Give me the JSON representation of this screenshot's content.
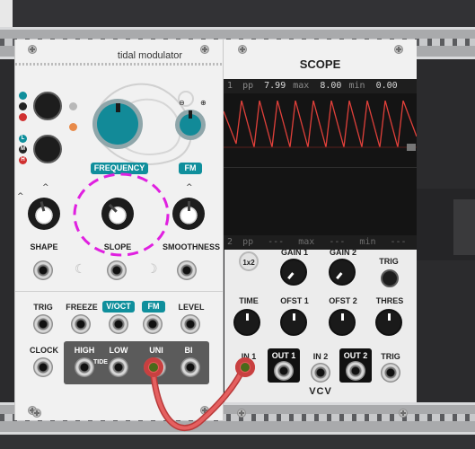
{
  "tidal": {
    "title": "tidal modulator",
    "frequency": "FREQUENCY",
    "fm": "FM",
    "shape": "SHAPE",
    "slope": "SLOPE",
    "smoothness": "SMOOTHNESS",
    "trig": "TRIG",
    "freeze": "FREEZE",
    "voct": "V/OCT",
    "fm2": "FM",
    "level": "LEVEL",
    "clock": "CLOCK",
    "high": "HIGH",
    "low": "LOW",
    "tide": "TIDE",
    "uni": "UNI",
    "bi": "BI",
    "leds_top": [
      "",
      "",
      ""
    ],
    "leds_bottom": [
      "L",
      "M",
      "H"
    ]
  },
  "scope": {
    "title": "SCOPE",
    "ch1": {
      "num": "1",
      "pp": "pp",
      "pp_val": "7.99",
      "max": "max",
      "max_val": "8.00",
      "min": "min",
      "min_val": "0.00"
    },
    "ch2": {
      "num": "2",
      "pp": "pp",
      "pp_val": "---",
      "max": "max",
      "max_val": "---",
      "min": "min",
      "min_val": "---"
    }
  },
  "vcv": {
    "x1x2": "1x2",
    "gain1": "GAIN 1",
    "gain2": "GAIN 2",
    "trig": "TRIG",
    "time": "TIME",
    "ofst1": "OFST 1",
    "ofst2": "OFST 2",
    "thres": "THRES",
    "in1": "IN 1",
    "out1": "OUT 1",
    "in2": "IN 2",
    "out2": "OUT 2",
    "trig2": "TRIG",
    "logo": "VCV"
  },
  "colors": {
    "accent": "#0f8f9c",
    "trace": "#e0403a",
    "cable": "#e55a5a",
    "highlight": "#e020e0"
  }
}
